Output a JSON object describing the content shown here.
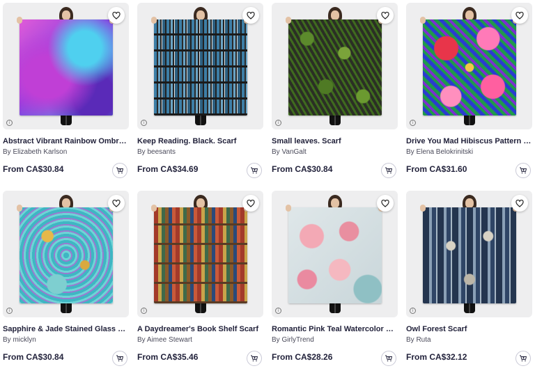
{
  "products": [
    {
      "title": "Abstract Vibrant Rainbow Ombre S...",
      "artist": "By Elizabeth Karlson",
      "price": "From CA$30.84",
      "pattern": "p-rainbow"
    },
    {
      "title": "Keep Reading. Black. Scarf",
      "artist": "By beesants",
      "price": "From CA$34.69",
      "pattern": "p-books"
    },
    {
      "title": "Small leaves. Scarf",
      "artist": "By VanGalt",
      "price": "From CA$30.84",
      "pattern": "p-leaves"
    },
    {
      "title": "Drive You Mad Hibiscus Pattern Sc...",
      "artist": "By Elena Belokrinitski",
      "price": "From CA$31.60",
      "pattern": "p-hibiscus"
    },
    {
      "title": "Sapphire & Jade Stained Glass Ma...",
      "artist": "By micklyn",
      "price": "From CA$30.84",
      "pattern": "p-sapphire"
    },
    {
      "title": "A Daydreamer's Book Shelf Scarf",
      "artist": "By Aimee Stewart",
      "price": "From CA$35.46",
      "pattern": "p-bookshelf"
    },
    {
      "title": "Romantic Pink Teal Watercolor Chi...",
      "artist": "By GirlyTrend",
      "price": "From CA$28.26",
      "pattern": "p-pink"
    },
    {
      "title": "Owl Forest Scarf",
      "artist": "By Ruta",
      "price": "From CA$32.12",
      "pattern": "p-owl"
    }
  ],
  "icons": {
    "favorite": "heart-icon",
    "cart": "add-to-cart-icon",
    "info": "info-icon"
  },
  "colors": {
    "text": "#22223b",
    "thumb_bg": "#eeeeef"
  }
}
